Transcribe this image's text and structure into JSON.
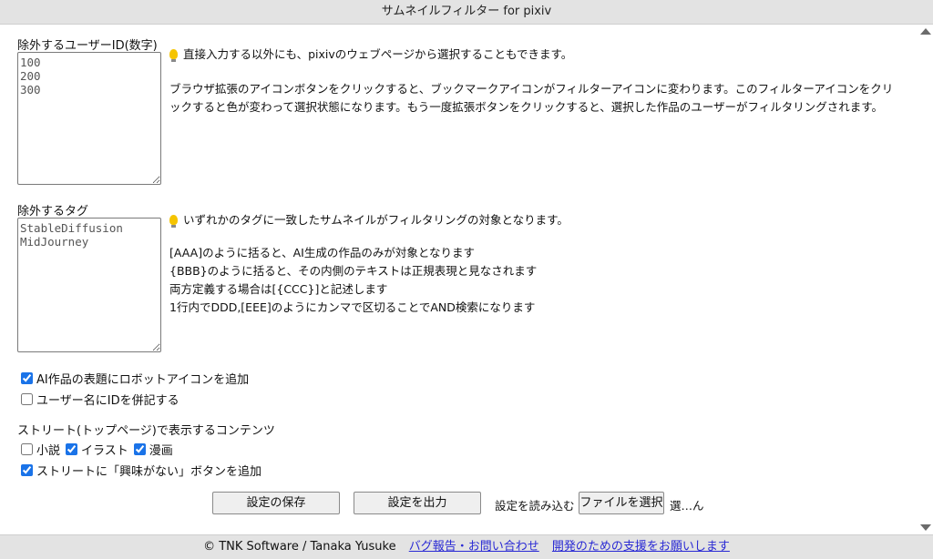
{
  "window": {
    "title": "サムネイルフィルター for pixiv"
  },
  "user_ids": {
    "label": "除外するユーザーID(数字)",
    "value": "100\n200\n300",
    "help": [
      "直接入力する以外にも、pixivのウェブページから選択することもできます。",
      "ブラウザ拡張のアイコンボタンをクリックすると、ブックマークアイコンがフィルターアイコンに変わります。このフィルターアイコンをクリックすると色が変わって選択状態になります。もう一度拡張ボタンをクリックすると、選択した作品のユーザーがフィルタリングされます。"
    ]
  },
  "tags": {
    "label": "除外するタグ",
    "value": "StableDiffusion\nMidJourney",
    "help": [
      "いずれかのタグに一致したサムネイルがフィルタリングの対象となります。",
      "[AAA]のように括ると、AI生成の作品のみが対象となります",
      "{BBB}のように括ると、その内側のテキストは正規表現と見なされます",
      "両方定義する場合は[{CCC}]と記述します",
      "1行内でDDD,[EEE]のようにカンマで区切ることでAND検索になります"
    ]
  },
  "options": {
    "robot_icon": {
      "label": "AI作品の表題にロボットアイコンを追加",
      "checked": true
    },
    "show_id": {
      "label": "ユーザー名にIDを併記する",
      "checked": false
    }
  },
  "street": {
    "label": "ストリート(トップページ)で表示するコンテンツ",
    "novel": {
      "label": "小説",
      "checked": false
    },
    "illust": {
      "label": "イラスト",
      "checked": true
    },
    "manga": {
      "label": "漫画",
      "checked": true
    },
    "not_interested": {
      "label": "ストリートに「興味がない」ボタンを追加",
      "checked": true
    }
  },
  "actions": {
    "save_label": "設定の保存",
    "export_label": "設定を出力",
    "import_label": "設定を読み込む",
    "file_button_label": "ファイルを選択",
    "file_status": "選…ん"
  },
  "footer": {
    "copyright": "© TNK Software / Tanaka Yusuke",
    "bug_report_link": "バグ報告・お問い合わせ",
    "support_link": "開発のための支援をお願いします"
  },
  "colors": {
    "titlebar_bg": "#e3e3e3",
    "link": "#2a2ad4",
    "checkbox_accent": "#1a73e8",
    "tip_icon": "#f5c400"
  }
}
